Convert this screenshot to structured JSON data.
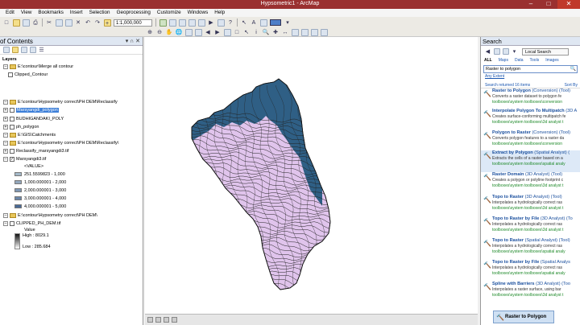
{
  "window": {
    "title": "Hypsometric1 - ArcMap"
  },
  "menu": [
    "Edit",
    "View",
    "Bookmarks",
    "Insert",
    "Selection",
    "Geoprocessing",
    "Customize",
    "Windows",
    "Help"
  ],
  "toolbar": {
    "scale": "1:1,000,000"
  },
  "toc": {
    "title": "of Contents",
    "layers_label": "Layers",
    "items": [
      {
        "label": "E:\\contour\\Merge all contour"
      },
      {
        "label": "Clipped_Contour"
      },
      {
        "label": "E:\\contour\\Hypsometry correct\\PH DEM\\Reclassify"
      },
      {
        "label": "Marsyangdi_polygon"
      },
      {
        "label": "BUDHIGANDAKI_POLY"
      },
      {
        "label": "ph_polygon"
      },
      {
        "label": "E:\\GIS\\Catchments"
      },
      {
        "label": "E:\\contour\\Hypsometry correct\\PH DEM\\Reclassify\\"
      },
      {
        "label": "Reclassify_marsyangdi3.tif"
      },
      {
        "label": "Marsyangdi3.tif"
      },
      {
        "label": "<VALUE>"
      },
      {
        "label": "251.5599823 - 1,000"
      },
      {
        "label": "1,000.000001 - 2,000"
      },
      {
        "label": "2,000.000001 - 3,000"
      },
      {
        "label": "3,000.000001 - 4,000"
      },
      {
        "label": "4,000.000001 - 5,000"
      },
      {
        "label": "E:\\contour\\Hypsometry correct\\PH DEM\\"
      },
      {
        "label": "CLIPPED_PH_DEM.tif"
      },
      {
        "label": "Value"
      },
      {
        "label": "High : 8029.1"
      },
      {
        "label": "Low : 285.684"
      }
    ],
    "class_colors": [
      "#a4b9c9",
      "#93a8bd",
      "#8098b4",
      "#6b86a8",
      "#4a6a96"
    ]
  },
  "map": {
    "polygon_color": "#e0c4ec",
    "highland_color": "#2f5f85"
  },
  "search": {
    "title": "Search",
    "local_search": "Local Search",
    "tabs": [
      "ALL",
      "Maps",
      "Data",
      "Tools",
      "Images"
    ],
    "query": "Raster to polygon",
    "any_extent": "Any Extent",
    "returned": "Search returned 16 items",
    "sort": "Sort By",
    "results": [
      {
        "title": "Raster to Polygon",
        "kind": "(Conversion) (Tool)",
        "desc": "Converts a raster dataset to polygon fe",
        "path": "toolboxes\\system toolboxes\\conversion"
      },
      {
        "title": "Interpolate Polygon To Multipatch",
        "kind": "(3D A",
        "desc": "Creates surface-conforming multipatch fe",
        "path": "toolboxes\\system toolboxes\\3d analyst t"
      },
      {
        "title": "Polygon to Raster",
        "kind": "(Conversion) (Tool)",
        "desc": "Converts polygon features to a raster da",
        "path": "toolboxes\\system toolboxes\\conversion"
      },
      {
        "title": "Extract by Polygon",
        "kind": "(Spatial Analyst) (",
        "desc": "Extracts the cells of a raster based on a",
        "path": "toolboxes\\system toolboxes\\spatial analy"
      },
      {
        "title": "Raster Domain",
        "kind": "(3D Analyst) (Tool)",
        "desc": "Creates a polygon or polyline footprint c",
        "path": "toolboxes\\system toolboxes\\3d analyst t"
      },
      {
        "title": "Topo to Raster",
        "kind": "(3D Analyst) (Tool)",
        "desc": "Interpolates a hydrologically correct ras",
        "path": "toolboxes\\system toolboxes\\3d analyst t"
      },
      {
        "title": "Topo to Raster by File",
        "kind": "(3D Analyst) (To",
        "desc": "Interpolates a hydrologically correct ras",
        "path": "toolboxes\\system toolboxes\\3d analyst t"
      },
      {
        "title": "Topo to Raster",
        "kind": "(Spatial Analyst) (Tool)",
        "desc": "Interpolates a hydrologically correct ras",
        "path": "toolboxes\\system toolboxes\\spatial analy"
      },
      {
        "title": "Topo to Raster by File",
        "kind": "(Spatial Analys",
        "desc": "Interpolates a hydrologically correct ras",
        "path": "toolboxes\\system toolboxes\\spatial analy"
      },
      {
        "title": "Spline with Barriers",
        "kind": "(3D Analyst) (Too",
        "desc": "Interpolates a raster surface, using bar",
        "path": "toolboxes\\system toolboxes\\3d analyst t"
      }
    ],
    "drag_label": "Raster to Polygon"
  }
}
